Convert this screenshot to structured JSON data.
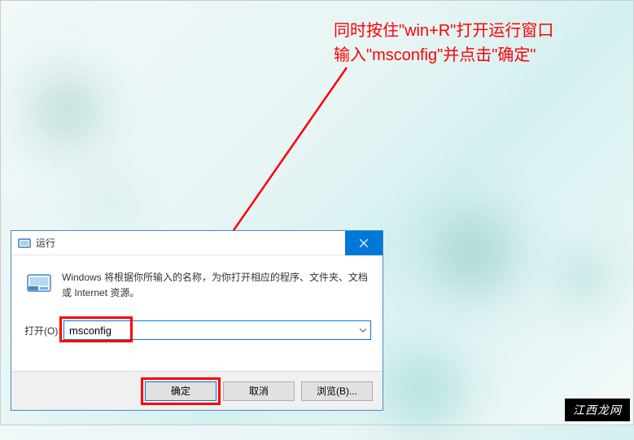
{
  "annotation": {
    "line1": "同时按住\"win+R\"打开运行窗口",
    "line2": "输入\"msconfig\"并点击\"确定\""
  },
  "dialog": {
    "title": "运行",
    "description": "Windows 将根据你所输入的名称，为你打开相应的程序、文件夹、文档或 Internet 资源。",
    "open_label": "打开(O):",
    "input_value": "msconfig",
    "ok_label": "确定",
    "cancel_label": "取消",
    "browse_label": "浏览(B)..."
  },
  "watermark": "江西龙网"
}
